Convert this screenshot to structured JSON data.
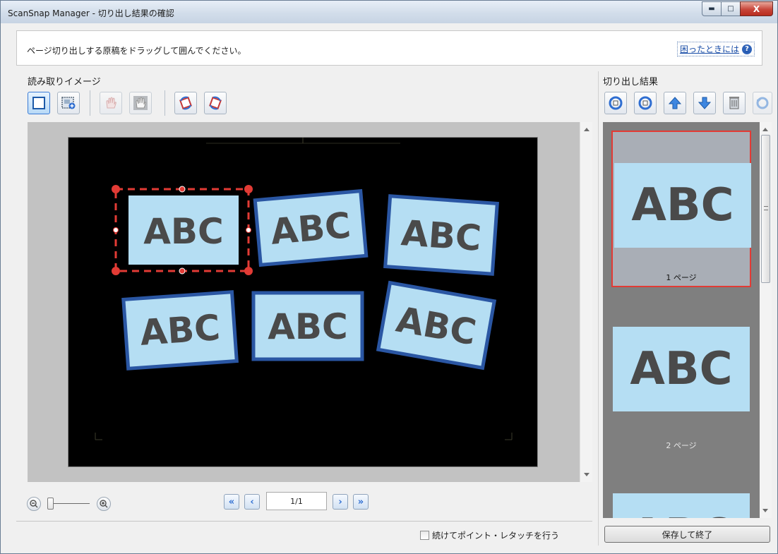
{
  "window": {
    "title": "ScanSnap Manager - 切り出し結果の確認",
    "min_label": "▬",
    "max_label": "□",
    "close_label": "X"
  },
  "instruction": {
    "text": "ページ切り出しする原稿をドラッグして囲んでください。",
    "help_label": "困ったときには",
    "help_icon": "?"
  },
  "left_pane": {
    "title": "読み取りイメージ",
    "tools": [
      "select-rect-icon",
      "add-area-icon",
      "hand-remove-icon",
      "hand-icon",
      "rotate-left-icon",
      "rotate-right-icon"
    ]
  },
  "scan": {
    "documents": [
      "ABC",
      "ABC",
      "ABC",
      "ABC",
      "ABC",
      "ABC"
    ]
  },
  "navigation": {
    "first": "«",
    "prev": "‹",
    "page": "1/1",
    "next": "›",
    "last": "»"
  },
  "zoom": {
    "level": 0
  },
  "options": {
    "continue_label": "続けてポイント・レタッチを行う",
    "checked": false
  },
  "right_pane": {
    "title": "切り出し結果",
    "tools": [
      "rotate-ccw-icon",
      "rotate-cw-icon",
      "move-up-icon",
      "move-down-icon",
      "delete-icon",
      "undo-icon"
    ],
    "pages": [
      {
        "image_text": "ABC",
        "label": "1 ページ",
        "selected": true
      },
      {
        "image_text": "ABC",
        "label": "2 ページ",
        "selected": false
      },
      {
        "image_text": "ABC",
        "label": "",
        "selected": false
      }
    ]
  },
  "actions": {
    "save_label": "保存して終了"
  },
  "colors": {
    "accent_blue": "#2f6ed1",
    "selection_red": "#e23b35",
    "doc_fill": "#b5def3",
    "doc_border": "#2a56a3"
  }
}
